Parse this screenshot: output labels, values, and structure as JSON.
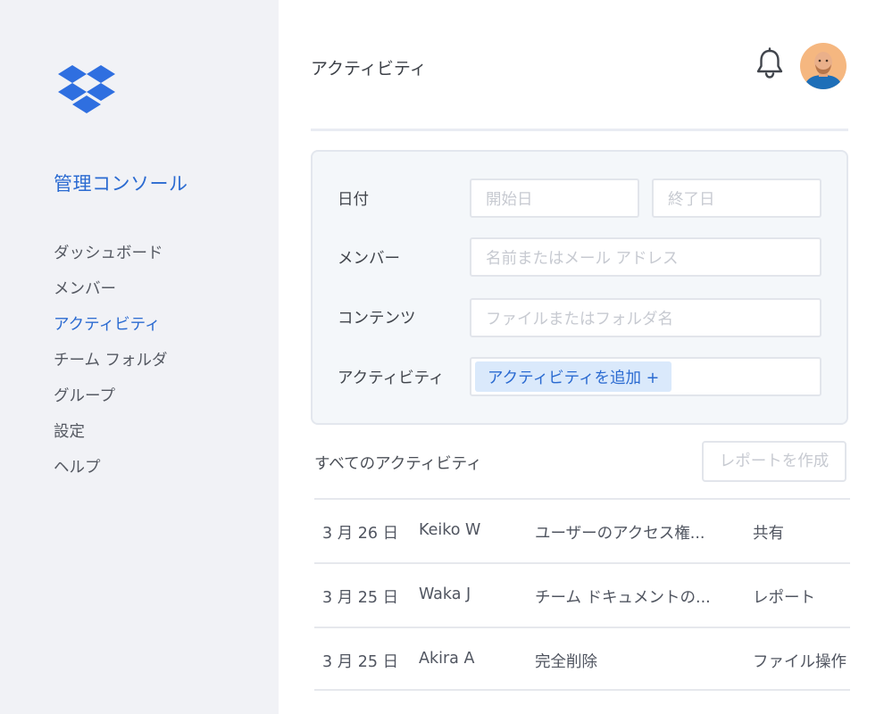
{
  "sidebar": {
    "console_title": "管理コンソール",
    "nav_items": [
      {
        "label": "ダッシュボード",
        "active": false
      },
      {
        "label": "メンバー",
        "active": false
      },
      {
        "label": "アクティビティ",
        "active": true
      },
      {
        "label": "チーム フォルダ",
        "active": false
      },
      {
        "label": "グループ",
        "active": false
      },
      {
        "label": "設定",
        "active": false
      },
      {
        "label": "ヘルプ",
        "active": false
      }
    ]
  },
  "header": {
    "title": "アクティビティ",
    "icons": [
      "bell-icon",
      "user-avatar"
    ]
  },
  "filters": {
    "date_label": "日付",
    "start_placeholder": "開始日",
    "end_placeholder": "終了日",
    "member_label": "メンバー",
    "member_placeholder": "名前またはメール アドレス",
    "content_label": "コンテンツ",
    "content_placeholder": "ファイルまたはフォルダ名",
    "activity_label": "アクティビティ",
    "add_activity": "アクティビティを追加 +"
  },
  "activity_list": {
    "title": "すべてのアクティビティ",
    "report_button": "レポートを作成",
    "rows": [
      {
        "date": "3 月 26 日",
        "user": "Keiko W",
        "description": "ユーザーのアクセス権...",
        "type": "共有"
      },
      {
        "date": "3 月 25 日",
        "user": "Waka J",
        "description": "チーム ドキュメントの...",
        "type": "レポート"
      },
      {
        "date": "3 月 25 日",
        "user": "Akira A",
        "description": "完全削除",
        "type": "ファイル操作"
      }
    ]
  },
  "colors": {
    "accent": "#2a6ad1",
    "sidebar_bg": "#f1f2f6",
    "panel_bg": "#f4f7fa",
    "chip_bg": "#dae9fb"
  }
}
